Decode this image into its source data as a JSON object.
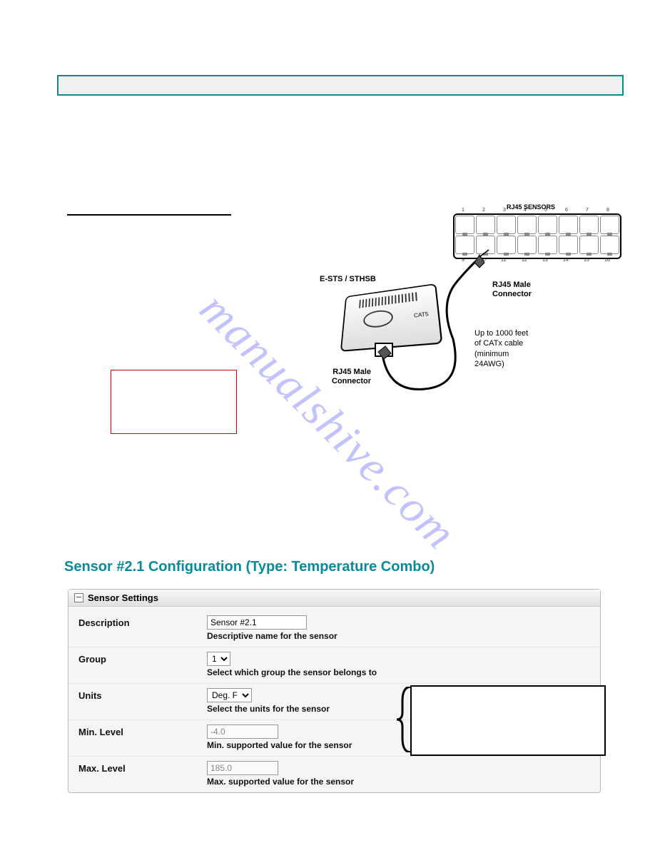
{
  "diagram": {
    "sensors_label": "RJ45 SENSORS",
    "device_label": "E-STS / STHSB",
    "conn_top": "RJ45 Male\nConnector",
    "cable_len": "Up to 1000 feet\nof CATx cable\n(minimum\n24AWG)",
    "conn_bottom": "RJ45 Male\nConnector",
    "cat5": "CAT5"
  },
  "config_title": "Sensor #2.1 Configuration (Type: Temperature Combo)",
  "panel_header": "Sensor Settings",
  "fields": {
    "description": {
      "label": "Description",
      "value": "Sensor #2.1",
      "help": "Descriptive name for the sensor"
    },
    "group": {
      "label": "Group",
      "value": "1",
      "help": "Select which group the sensor belongs to"
    },
    "units": {
      "label": "Units",
      "value": "Deg. F",
      "help": "Select the units for the sensor"
    },
    "min": {
      "label": "Min. Level",
      "value": "-4.0",
      "help": "Min. supported value for the sensor"
    },
    "max": {
      "label": "Max. Level",
      "value": "185.0",
      "help": "Max. supported value for the sensor"
    }
  },
  "watermark": "manualshive.com"
}
